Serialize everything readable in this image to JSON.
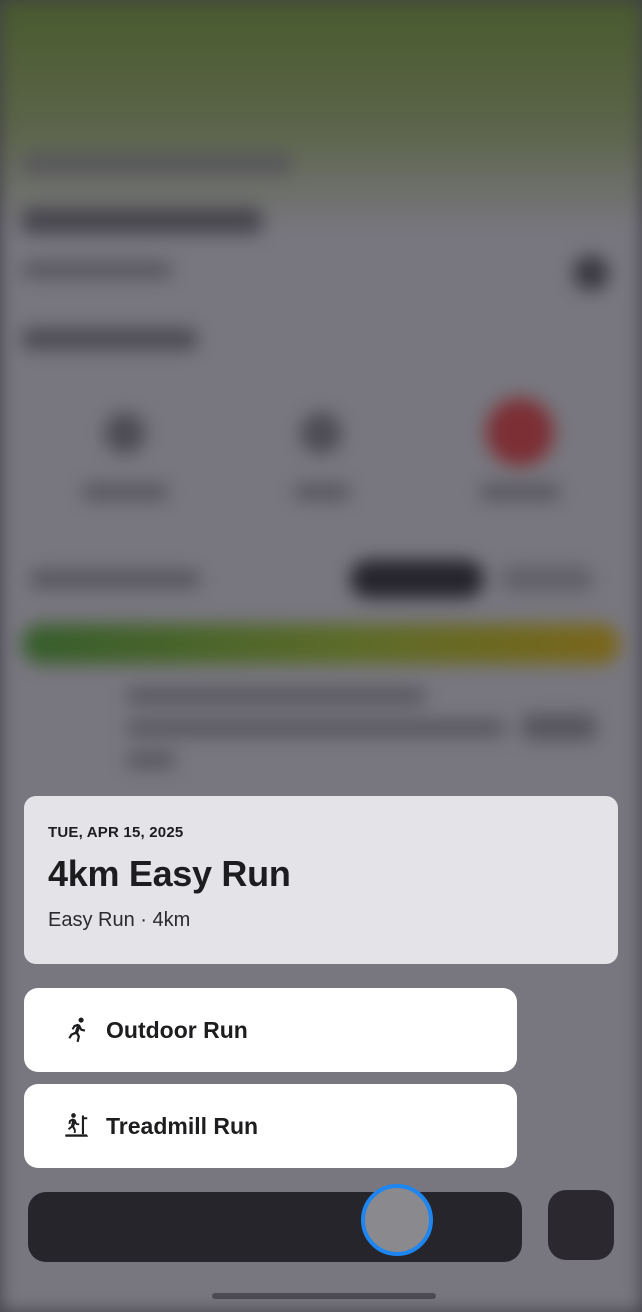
{
  "workout": {
    "date": "TUE, APR 15, 2025",
    "title": "4km Easy Run",
    "subtitle": "Easy Run · 4km"
  },
  "options": [
    {
      "label": "Outdoor Run",
      "icon": "outdoor-run-icon"
    },
    {
      "label": "Treadmill Run",
      "icon": "treadmill-run-icon"
    }
  ],
  "colors": {
    "accent": "#1d86f0",
    "card_bg": "#e4e3e7",
    "option_bg": "#ffffff",
    "scrim": "#5d5c62",
    "progress_start": "#48a028",
    "progress_end": "#e0b400",
    "status_red": "#e23b3b"
  }
}
